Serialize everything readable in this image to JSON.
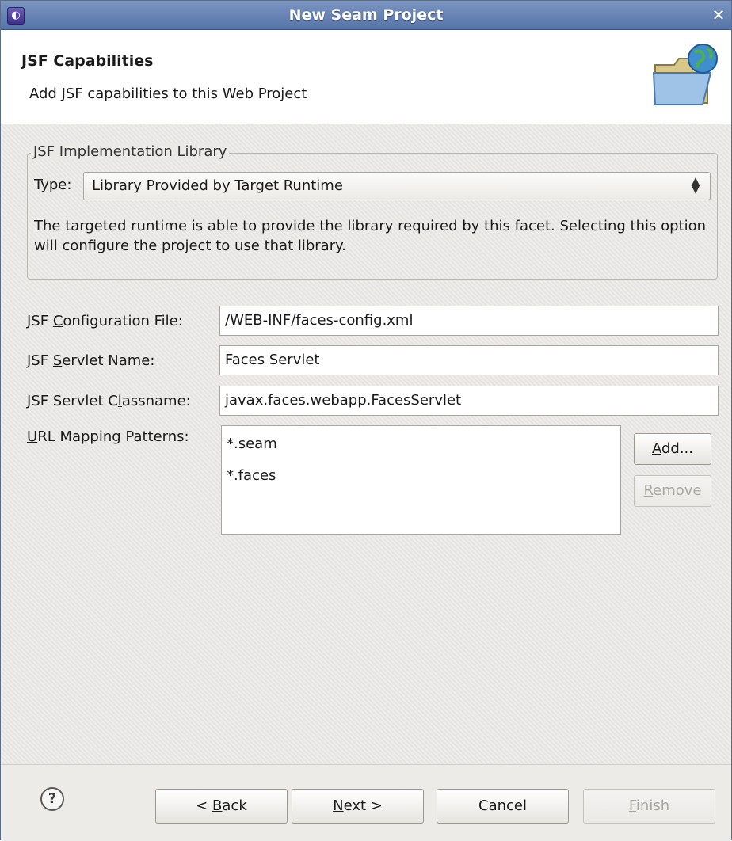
{
  "window": {
    "title": "New Seam Project"
  },
  "header": {
    "title": "JSF Capabilities",
    "description": "Add JSF capabilities to this Web Project"
  },
  "implementation_group": {
    "legend": "JSF Implementation Library",
    "type_label": "Type:",
    "type_value": "Library Provided by Target Runtime",
    "description": "The targeted runtime is able to provide the library required by this facet. Selecting this option will configure the project to use that library."
  },
  "form": {
    "config_file_label": "JSF Configuration File:",
    "config_file_value": "/WEB-INF/faces-config.xml",
    "servlet_name_label": "JSF Servlet Name:",
    "servlet_name_value": "Faces Servlet",
    "servlet_class_label": "JSF Servlet Classname:",
    "servlet_class_value": "javax.faces.webapp.FacesServlet",
    "url_patterns_label": "URL Mapping Patterns:",
    "url_patterns": [
      "*.seam",
      "*.faces"
    ],
    "add_label": "Add...",
    "remove_label": "Remove"
  },
  "footer": {
    "help_label": "?",
    "back_label": "< Back",
    "next_label": "Next >",
    "cancel_label": "Cancel",
    "finish_label": "Finish"
  },
  "icons": {
    "app": "eclipse-icon",
    "close": "close-icon",
    "wizard": "folder-globe-icon",
    "select_arrow": "updown-arrow-icon",
    "help": "help-icon"
  }
}
